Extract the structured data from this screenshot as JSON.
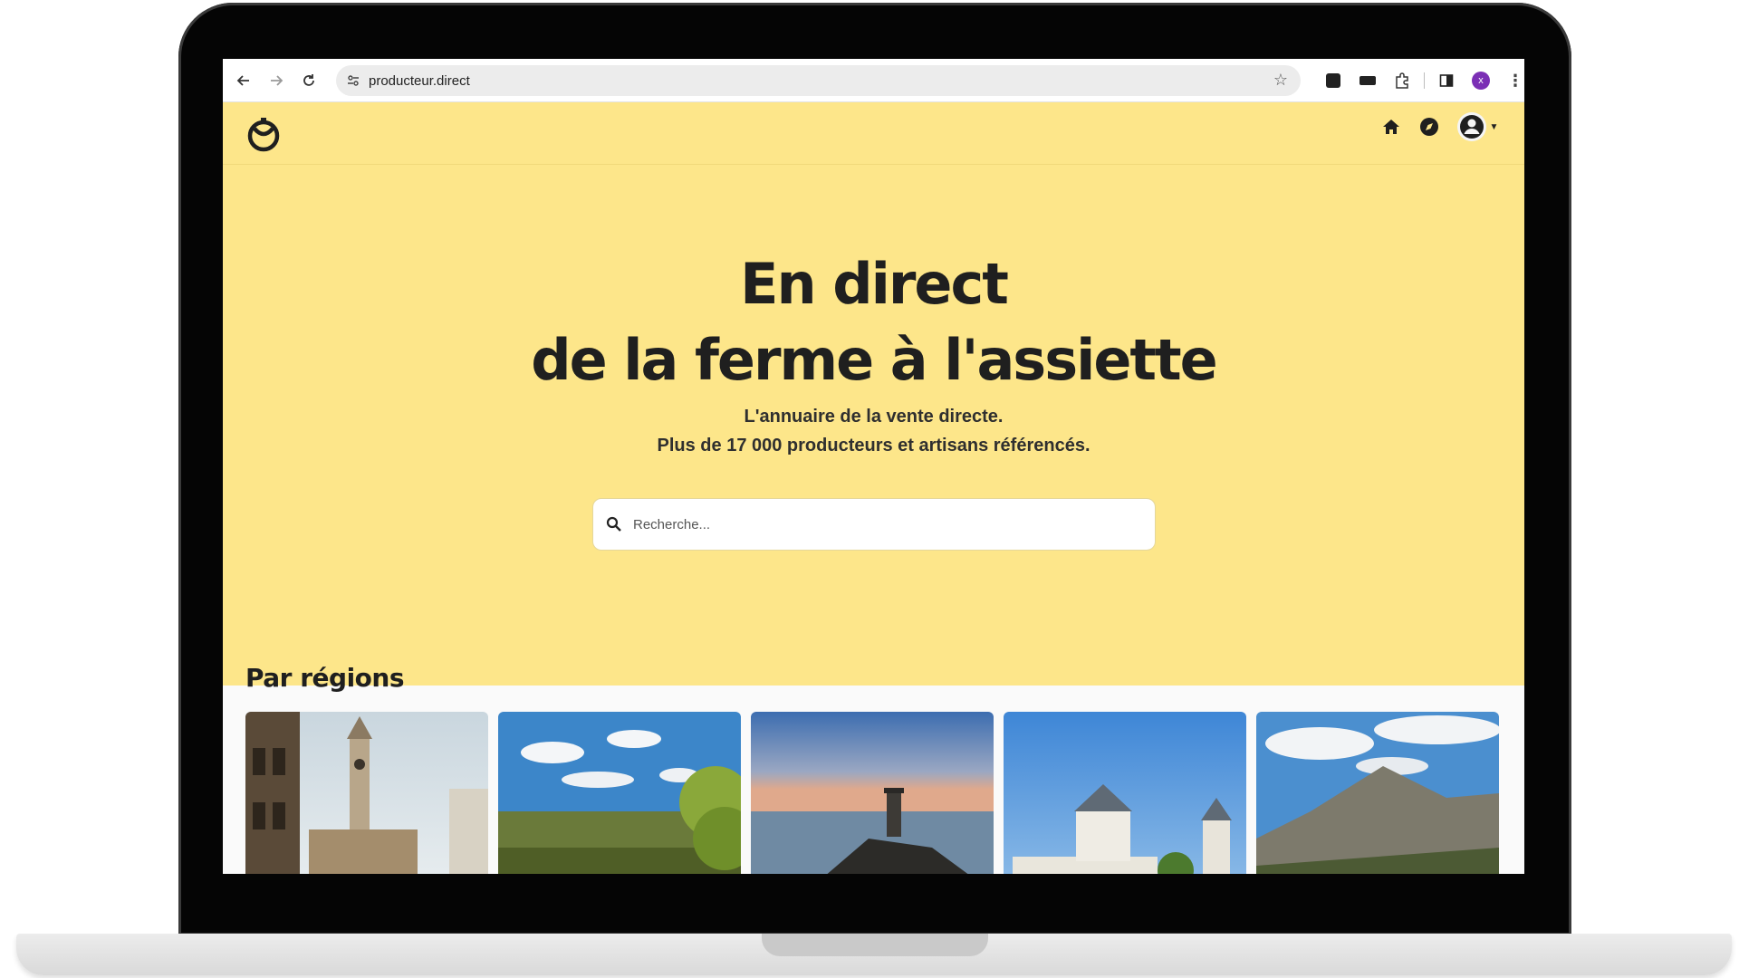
{
  "browser": {
    "url": "producteur.direct",
    "profile_initial": "x"
  },
  "icons": {
    "back": "arrow-left-icon",
    "forward": "arrow-right-icon",
    "reload": "reload-icon",
    "site_info": "tune-icon",
    "bookmark": "star-icon",
    "home": "home-icon",
    "explore": "compass-icon",
    "account": "user-circle-icon",
    "search": "search-icon"
  },
  "hero": {
    "title_line1": "En direct",
    "title_line2": "de la ferme à l'assiette",
    "subtitle_line1": "L'annuaire de la vente directe.",
    "subtitle_line2": "Plus de 17 000 producteurs et artisans référencés."
  },
  "search": {
    "placeholder": "Recherche..."
  },
  "regions": {
    "title": "Par régions",
    "cards": [
      {
        "scene": "belfry-tower-photo"
      },
      {
        "scene": "valley-landscape-photo"
      },
      {
        "scene": "lighthouse-sea-photo"
      },
      {
        "scene": "chateau-photo"
      },
      {
        "scene": "mountain-photo"
      }
    ]
  },
  "colors": {
    "brand_yellow": "#fde68a",
    "text_dark": "#1f1f1f"
  }
}
